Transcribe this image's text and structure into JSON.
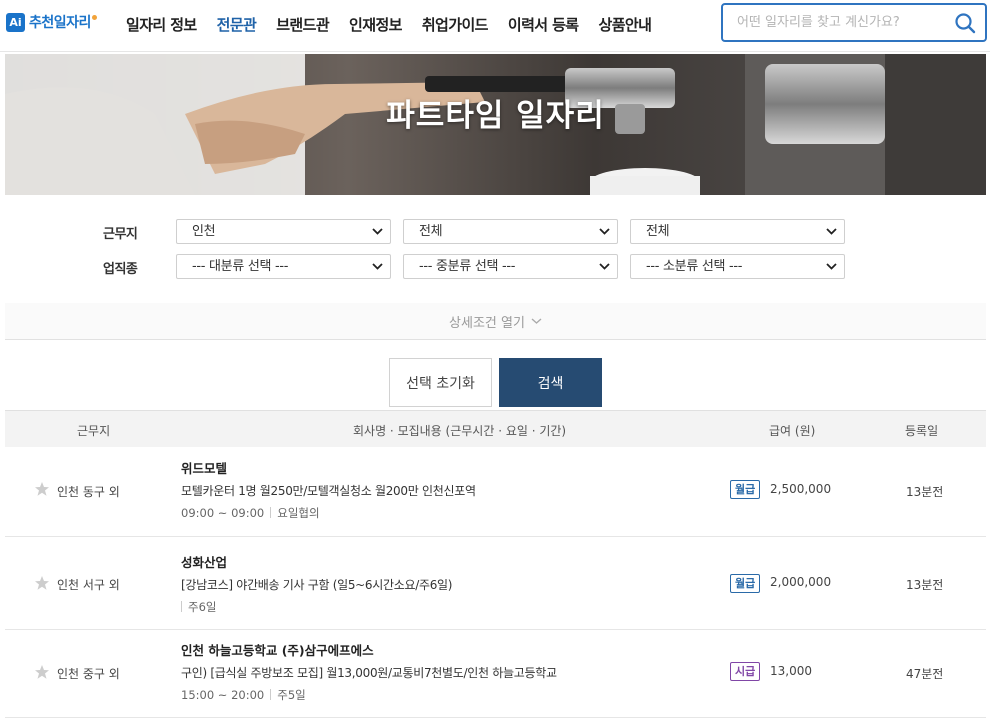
{
  "header": {
    "logo_badge": "Ai",
    "logo_text": "추천일자리",
    "nav": [
      "일자리 정보",
      "전문관",
      "브랜드관",
      "인재정보",
      "취업가이드",
      "이력서 등록",
      "상품안내"
    ],
    "active_nav": "전문관",
    "search_placeholder": "어떤 일자리를 찾고 계신가요?"
  },
  "banner": {
    "title": "파트타임 일자리"
  },
  "filters": {
    "location_label": "근무지",
    "location_values": [
      "인천",
      "전체",
      "전체"
    ],
    "job_label": "업직종",
    "job_values": [
      "--- 대분류 선택 ---",
      "--- 중분류 선택 ---",
      "--- 소분류 선택 ---"
    ]
  },
  "detail_toggle": "상세조건 열기",
  "buttons": {
    "reset": "선택 초기화",
    "search": "검색"
  },
  "table": {
    "headers": {
      "location": "근무지",
      "content": "회사명 · 모집내용 (근무시간 · 요일 · 기간)",
      "pay": "급여 (원)",
      "posted": "등록일"
    },
    "rows": [
      {
        "location": "인천 동구 외",
        "company": "위드모텔",
        "description": "모텔카운터 1명 월250만/모텔객실청소 월200만 인천신포역",
        "hours": "09:00 ~ 09:00",
        "days": "요일협의",
        "pay_type": "월급",
        "pay": "2,500,000",
        "posted": "13분전"
      },
      {
        "location": "인천 서구 외",
        "company": "성화산업",
        "description": "[강남코스] 야간배송 기사 구함 (일5~6시간소요/주6일)",
        "hours": "",
        "days": "주6일",
        "pay_type": "월급",
        "pay": "2,000,000",
        "posted": "13분전"
      },
      {
        "location": "인천 중구 외",
        "company": "인천 하늘고등학교 (주)삼구에프에스",
        "description": "구인) [급식실 주방보조 모집] 월13,000원/교통비7천별도/인천 하늘고등학교",
        "hours": "15:00 ~ 20:00",
        "days": "주5일",
        "pay_type": "시급",
        "pay": "13,000",
        "posted": "47분전"
      }
    ]
  },
  "colors": {
    "brand": "#1a73c9",
    "nav_active": "#1f62a8",
    "search_button": "#264b72",
    "monthly_badge": "#2a6aa8",
    "hourly_badge": "#8046a6"
  }
}
